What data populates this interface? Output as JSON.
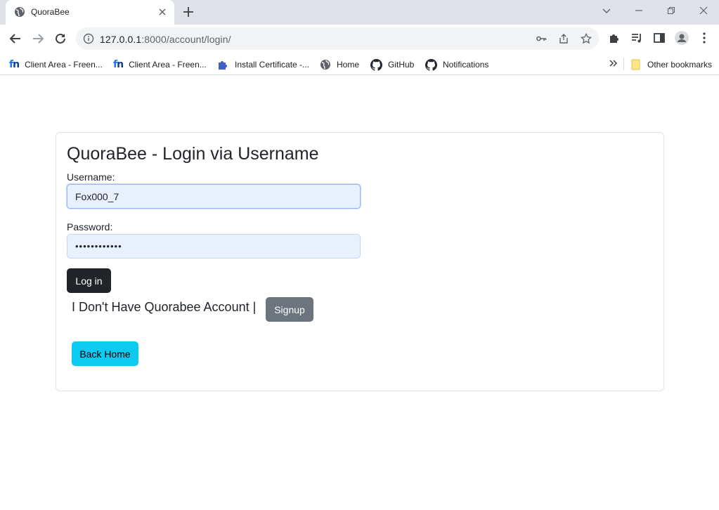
{
  "browser": {
    "tab_title": "QuoraBee",
    "url_host": "127.0.0.1",
    "url_path": ":8000/account/login/",
    "bookmarks": [
      {
        "label": "Client Area - Freen...",
        "icon": "freenom-icon"
      },
      {
        "label": "Client Area - Freen...",
        "icon": "freenom-icon"
      },
      {
        "label": "Install Certificate -...",
        "icon": "puzzle-icon"
      },
      {
        "label": "Home",
        "icon": "globe-icon"
      },
      {
        "label": "GitHub",
        "icon": "github-icon"
      },
      {
        "label": "Notifications",
        "icon": "github-icon"
      }
    ],
    "other_bookmarks": "Other bookmarks"
  },
  "page": {
    "heading": "QuoraBee - Login via Username",
    "username_label": "Username:",
    "username_value": "Fox000_7",
    "password_label": "Password:",
    "password_value": "••••••••••••",
    "login_button": "Log in",
    "no_account_text": "I Don't Have Quorabee Account |",
    "signup_button": "Signup",
    "back_home_button": "Back Home"
  },
  "colors": {
    "login_button": "#212529",
    "signup_button": "#6c757d",
    "back_home_button": "#0dcaf0",
    "input_autofill_bg": "#e8f0fe"
  }
}
